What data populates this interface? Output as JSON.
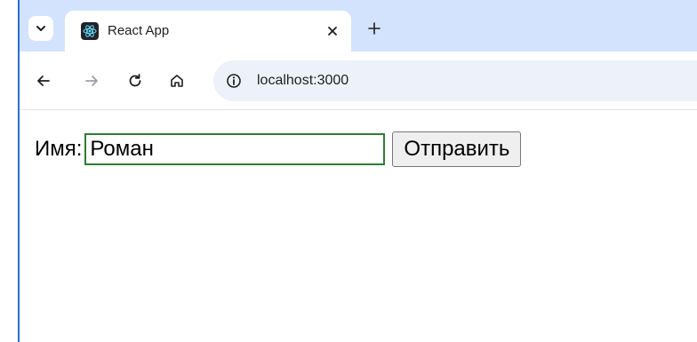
{
  "browser": {
    "tab": {
      "title": "React App",
      "favicon": "react-logo-icon"
    },
    "address_bar": {
      "url": "localhost:3000"
    },
    "icons": {
      "tab_search": "chevron-down-icon",
      "close_tab": "close-icon",
      "new_tab": "plus-icon",
      "back": "back-arrow-icon",
      "forward": "forward-arrow-icon",
      "reload": "reload-icon",
      "home": "home-icon",
      "site_info": "info-icon"
    },
    "colors": {
      "tabstrip": "#d3e3fd",
      "omnibox": "#edf2fa",
      "window_edge": "#2b6fd1"
    }
  },
  "page": {
    "form": {
      "label": "Имя:",
      "input_value": "Роман",
      "submit_label": "Отправить",
      "input_border_color": "#2e7d32"
    }
  }
}
